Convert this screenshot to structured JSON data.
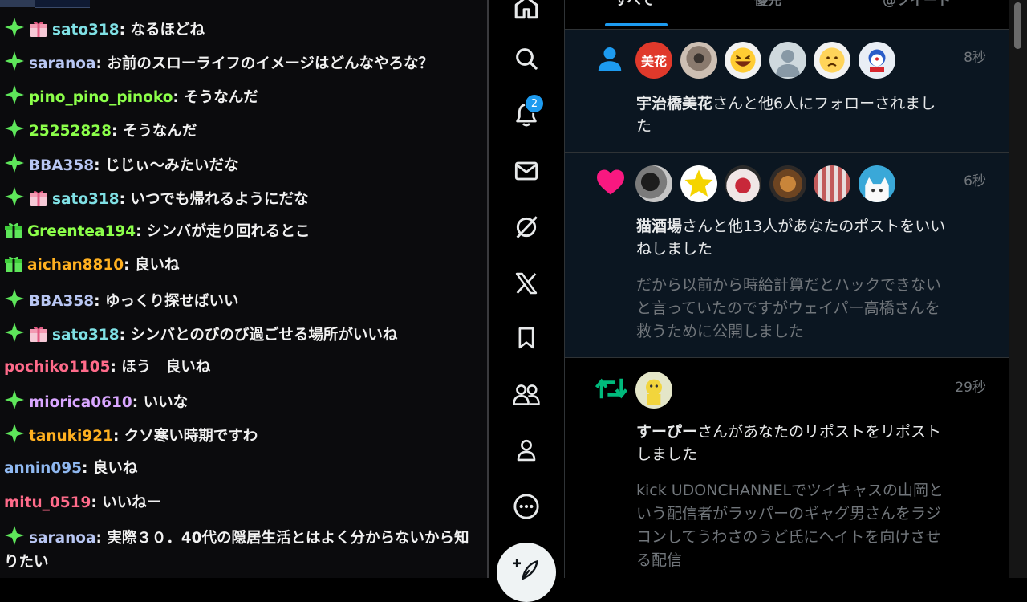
{
  "chat": {
    "messages": [
      {
        "user": "sato318",
        "color": "#7fe0e4",
        "badges": [
          "diamond",
          "gift"
        ],
        "text": "なるほどね"
      },
      {
        "user": "saranoa",
        "color": "#b8c6f2",
        "badges": [
          "diamond"
        ],
        "text": "お前のスローライフのイメージはどんなやろな？"
      },
      {
        "user": "pino_pino_pinoko",
        "color": "#8cff4a",
        "badges": [
          "diamond"
        ],
        "text": "そうなんだ"
      },
      {
        "user": "25252828",
        "color": "#8cff4a",
        "badges": [
          "diamond"
        ],
        "text": "そうなんだ"
      },
      {
        "user": "BBA358",
        "color": "#b8c6f2",
        "badges": [
          "diamond"
        ],
        "text": "じじぃ〜みたいだな"
      },
      {
        "user": "sato318",
        "color": "#7fe0e4",
        "badges": [
          "diamond",
          "gift"
        ],
        "text": "いつでも帰れるようにだな"
      },
      {
        "user": "Greentea194",
        "color": "#8cff4a",
        "badges": [
          "giftgreen"
        ],
        "text": "シンバが走り回れるとこ"
      },
      {
        "user": "aichan8810",
        "color": "#ffb020",
        "badges": [
          "giftgreen"
        ],
        "text": "良いね"
      },
      {
        "user": "BBA358",
        "color": "#b8c6f2",
        "badges": [
          "diamond"
        ],
        "text": "ゆっくり探せばいい"
      },
      {
        "user": "sato318",
        "color": "#7fe0e4",
        "badges": [
          "diamond",
          "gift"
        ],
        "text": "シンバとのびのび過ごせる場所がいいね"
      },
      {
        "user": "pochiko1105",
        "color": "#ff6b8a",
        "badges": [],
        "text": "ほう　良いね"
      },
      {
        "user": "miorica0610",
        "color": "#d9a6ff",
        "badges": [
          "diamond"
        ],
        "text": "いいな"
      },
      {
        "user": "tanuki921",
        "color": "#ffb020",
        "badges": [
          "diamond"
        ],
        "text": "クソ寒い時期ですわ"
      },
      {
        "user": "annin095",
        "color": "#8fb8f0",
        "badges": [],
        "text": "良いね"
      },
      {
        "user": "mitu_0519",
        "color": "#ff6b8a",
        "badges": [],
        "text": "いいねー"
      },
      {
        "user": "saranoa",
        "color": "#b8c6f2",
        "badges": [
          "diamond"
        ],
        "text": "実際３０．40代の隠居生活とはよく分からないから知りたい"
      }
    ]
  },
  "nav": {
    "items": [
      {
        "name": "home-icon"
      },
      {
        "name": "search-icon"
      },
      {
        "name": "bell-icon"
      },
      {
        "name": "mail-icon"
      },
      {
        "name": "grok-icon"
      },
      {
        "name": "x-logo-icon"
      },
      {
        "name": "bookmark-icon"
      },
      {
        "name": "communities-icon"
      },
      {
        "name": "profile-icon"
      },
      {
        "name": "more-icon"
      }
    ],
    "notification_count": "2",
    "compose_icon": "compose-icon"
  },
  "notifications": {
    "tabs": [
      {
        "label": "すべて",
        "active": true
      },
      {
        "label": "優先",
        "active": false
      },
      {
        "label": "@ツイート",
        "active": false
      }
    ],
    "items": [
      {
        "type": "follow",
        "time": "8秒",
        "avatar_text": "美花",
        "actor": "宇治橋美花",
        "action": "さんと他6人にフォローされました",
        "snippet": ""
      },
      {
        "type": "like",
        "time": "6秒",
        "actor": "猫酒場",
        "action": "さんと他13人があなたのポストをいいねしました",
        "snippet": "だから以前から時給計算だとハックできないと言っていたのですがウェイパー高橋さんを救うために公開しました"
      },
      {
        "type": "repost",
        "time": "29秒",
        "actor": "すーぴー",
        "action": "さんがあなたのリポストをリポストしました",
        "snippet": "kick UDONCHANNELでツイキャスの山岡という配信者がラッパーのギャグ男さんをラジコンしてうわさのうど氏にヘイトを向けさせる配信"
      }
    ]
  },
  "colors": {
    "accent": "#1d9bf0",
    "like": "#f91880",
    "repost": "#00ba7c",
    "unread_bg": "#0b1621"
  }
}
